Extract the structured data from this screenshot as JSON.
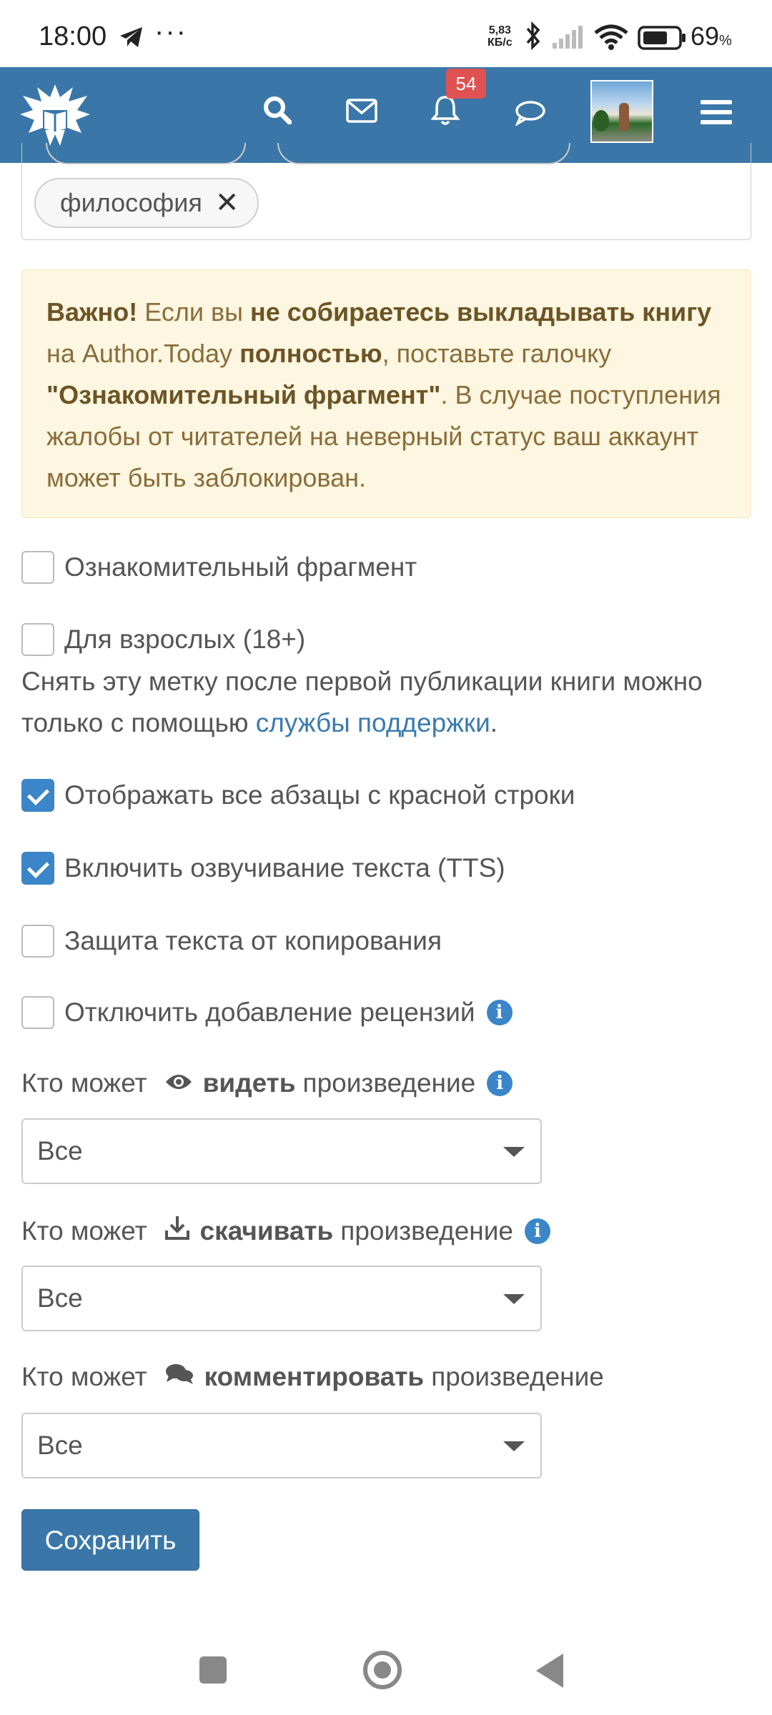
{
  "status_bar": {
    "time": "18:00",
    "speed_top": "5,83",
    "speed_bottom": "КБ/с",
    "battery_pct": "69",
    "battery_sign": "%"
  },
  "header": {
    "notification_count": "54",
    "icons": [
      "search-icon",
      "mail-icon",
      "bell-icon",
      "chat-icon",
      "avatar",
      "menu-icon"
    ]
  },
  "tags": {
    "visible_tag": "философия",
    "remove_glyph": "✕"
  },
  "alert": {
    "important": "Важно!",
    "t1": " Если вы ",
    "b1": "не собираетесь выкладывать книгу",
    "t2": " на Author.Today ",
    "b2": "полностью",
    "t3": ", поставьте галочку ",
    "b3": "\"Ознакомительный фрагмент\"",
    "t4": ". В случае поступления жалобы от читателей на неверный статус ваш аккаунт может быть заблокирован."
  },
  "checkboxes": {
    "excerpt": {
      "label": "Ознакомительный фрагмент",
      "checked": false
    },
    "adult": {
      "label": "Для взрослых (18+)",
      "checked": false
    },
    "red_line": {
      "label": "Отображать все абзацы с красной строки",
      "checked": true
    },
    "tts": {
      "label": "Включить озвучивание текста (TTS)",
      "checked": true
    },
    "copy_protect": {
      "label": "Защита текста от копирования",
      "checked": false
    },
    "disable_reviews": {
      "label": "Отключить добавление рецензий",
      "checked": false
    }
  },
  "adult_note": {
    "text": "Снять эту метку после первой публикации книги можно только с помощью ",
    "link": "службы поддержки",
    "end": "."
  },
  "permissions": {
    "who_can": "Кто может",
    "work": "произведение",
    "view": {
      "verb": "видеть",
      "value": "Все"
    },
    "download": {
      "verb": "скачивать",
      "value": "Все"
    },
    "comment": {
      "verb": "комментировать",
      "value": "Все"
    }
  },
  "save_label": "Сохранить",
  "info_glyph": "i",
  "colors": {
    "header": "#3a77a8",
    "alert_bg": "#fdf6e0",
    "alert_text": "#8a6d3b",
    "checkbox_checked": "#3a86c8",
    "link": "#3a7bb0",
    "badge": "#e05252"
  }
}
